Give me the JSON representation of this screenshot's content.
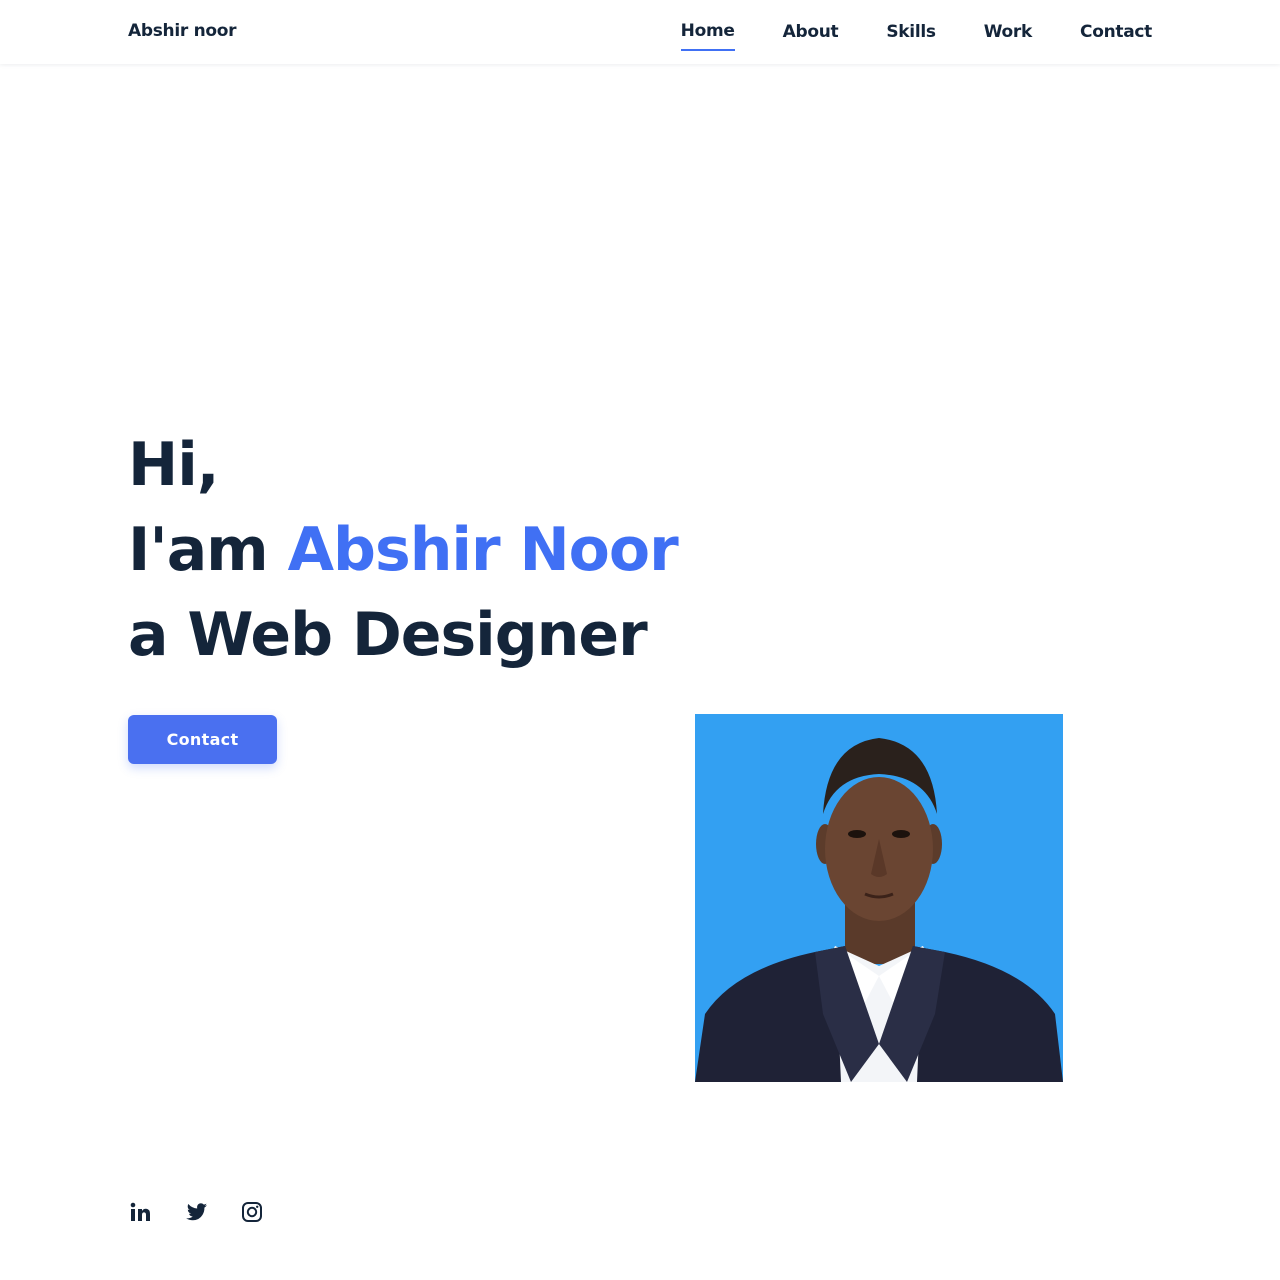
{
  "header": {
    "logo": "Abshir noor",
    "nav": [
      {
        "label": "Home",
        "active": true
      },
      {
        "label": "About",
        "active": false
      },
      {
        "label": "Skills",
        "active": false
      },
      {
        "label": "Work",
        "active": false
      },
      {
        "label": "Contact",
        "active": false
      }
    ]
  },
  "hero": {
    "line1": "Hi,",
    "line2_prefix": "I'am ",
    "name": "Abshir Noor",
    "line3": "a Web Designer",
    "button_label": "Contact",
    "image_icon": "profile-photo"
  },
  "social": [
    {
      "icon": "linkedin-icon"
    },
    {
      "icon": "twitter-icon"
    },
    {
      "icon": "instagram-icon"
    }
  ],
  "colors": {
    "accent": "#4070f4",
    "button": "#4a70f0",
    "text": "#14253a",
    "photo_background": "#33a0f2"
  }
}
